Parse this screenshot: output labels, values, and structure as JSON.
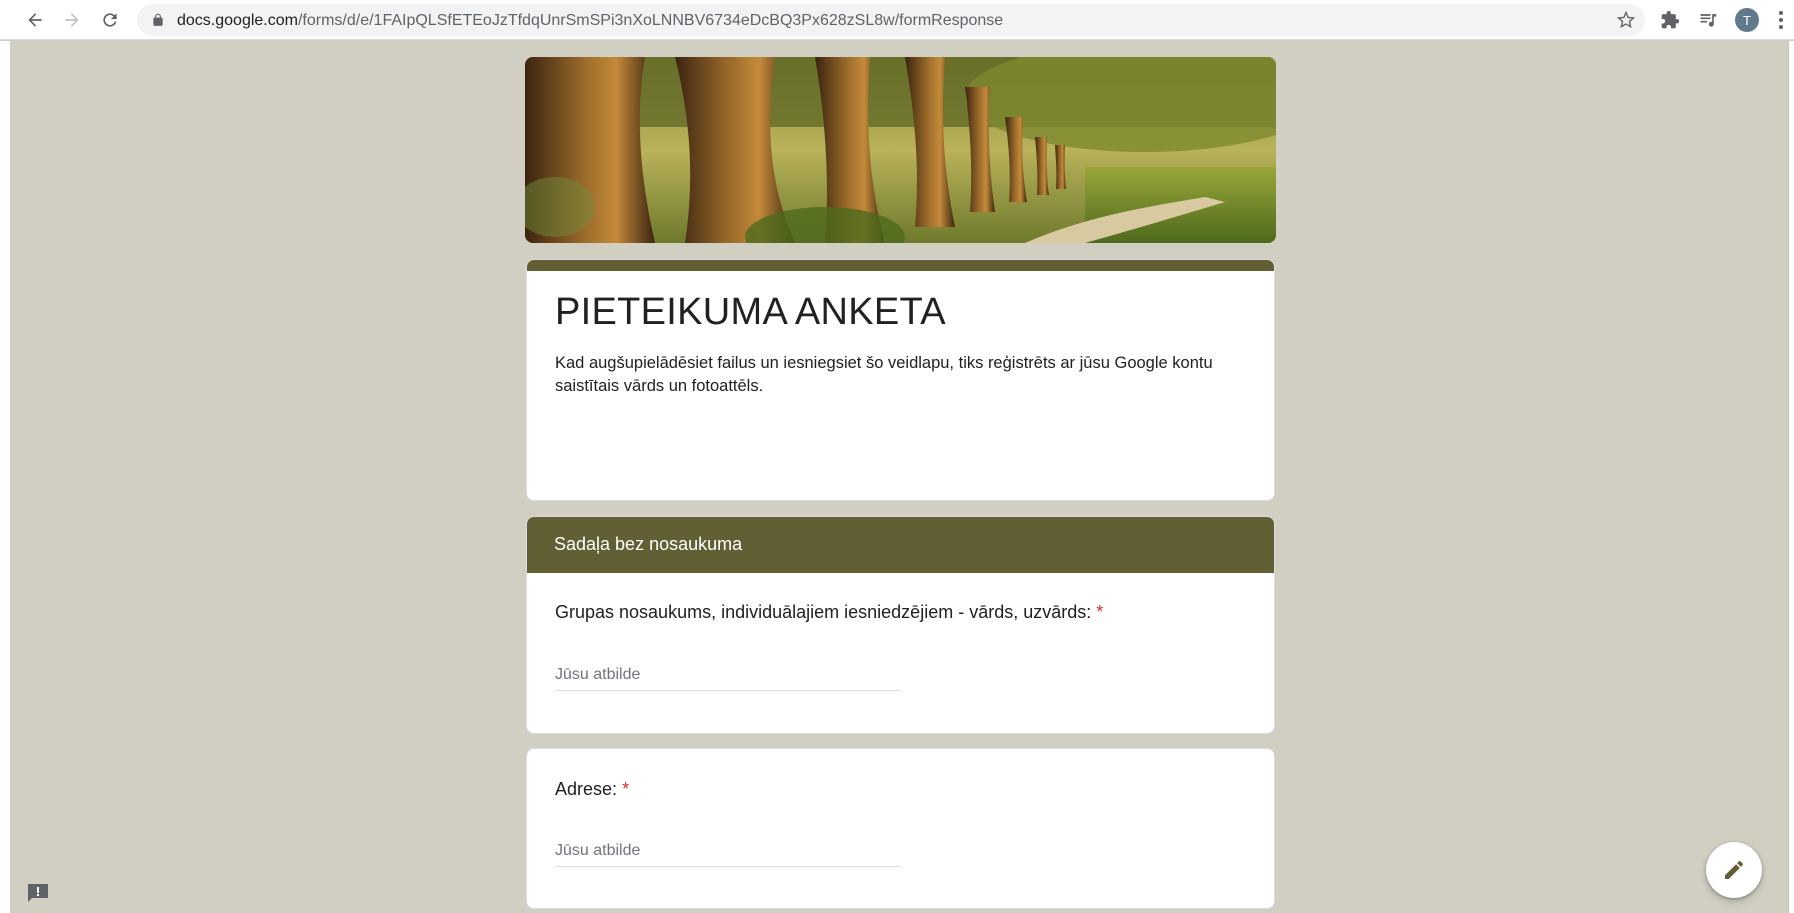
{
  "browser": {
    "url_host": "docs.google.com",
    "url_path": "/forms/d/e/1FAIpQLSfETEoJzTfdqUnrSmSPi3nXoLNNBV6734eDcBQ3Px628zSL8w/formResponse",
    "avatar_letter": "T",
    "icons": [
      "back-icon",
      "forward-icon",
      "reload-icon",
      "lock-icon",
      "star-icon",
      "extensions-icon",
      "media-queue-icon",
      "menu-kebab-icon"
    ]
  },
  "form": {
    "title": "PIETEIKUMA ANKETA",
    "description": "Kad augšupielādēsiet failus un iesniegsiet šo veidlapu, tiks reģistrēts ar jūsu Google kontu saistītais vārds un fotoattēls.",
    "section_title": "Sadaļa bez nosaukuma",
    "questions": [
      {
        "label": "Grupas nosaukums, individuālajiem iesniedzējiem - vārds, uzvārds:",
        "required_mark": "*",
        "placeholder": "Jūsu atbilde"
      },
      {
        "label": "Adrese:",
        "required_mark": "*",
        "placeholder": "Jūsu atbilde"
      }
    ]
  },
  "colors": {
    "accent": "#625f34",
    "background": "#d0cfc2",
    "required": "#d93025"
  }
}
